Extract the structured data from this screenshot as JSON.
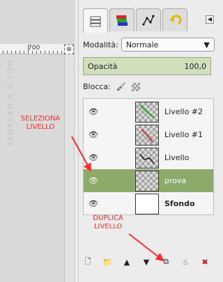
{
  "canvas": {
    "ruler_label": "700",
    "watermark": "SKDREAM.A.A.COM"
  },
  "dock": {
    "tabs": [
      "layers",
      "channels",
      "paths",
      "undo-history"
    ],
    "mode_label": "Modalità:",
    "mode_value": "Normale",
    "opacity_label": "Opacità",
    "opacity_value": "100,0",
    "lock_label": "Blocca:"
  },
  "layers": [
    {
      "name": "Livello #2",
      "visible": true,
      "selected": false,
      "bold": false
    },
    {
      "name": "Livello #1",
      "visible": true,
      "selected": false,
      "bold": false
    },
    {
      "name": "Livello",
      "visible": true,
      "selected": false,
      "bold": false
    },
    {
      "name": "prova",
      "visible": true,
      "selected": true,
      "bold": false
    },
    {
      "name": "Sfondo",
      "visible": true,
      "selected": false,
      "bold": true
    }
  ],
  "annotations": {
    "select": "SELEZIONA LIVELLO",
    "duplicate": "DUPLICA LIVELLO"
  },
  "colors": {
    "selected_row": "#8caa6a",
    "opacity_fill": "#cfe0bb",
    "annotation": "#ff2a2a"
  }
}
